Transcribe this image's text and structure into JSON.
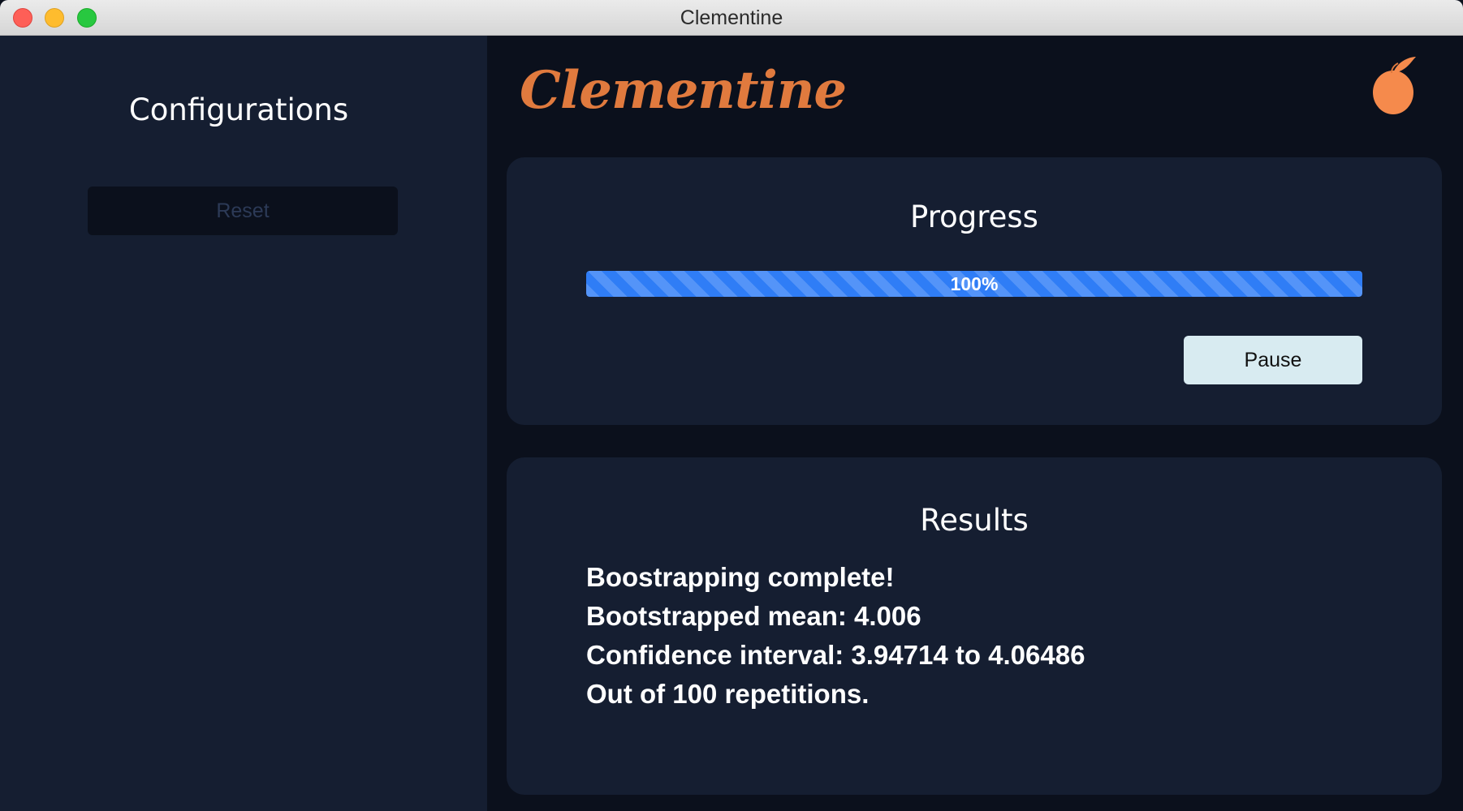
{
  "window": {
    "title": "Clementine"
  },
  "sidebar": {
    "heading": "Configurations",
    "reset_label": "Reset"
  },
  "header": {
    "brand": "Clementine",
    "logo_icon": "orange-fruit-icon"
  },
  "progress": {
    "title": "Progress",
    "percent": 100,
    "label": "100%",
    "pause_label": "Pause"
  },
  "results": {
    "title": "Results",
    "lines": [
      "Boostrapping complete!",
      "Bootstrapped mean: 4.006",
      "Confidence interval: 3.94714 to 4.06486",
      "Out of 100 repetitions."
    ]
  },
  "colors": {
    "accent_orange": "#e07a3e",
    "progress_blue": "#2f7df6",
    "panel": "#151e31",
    "background": "#0b101c",
    "pause_button": "#d8ebf1"
  }
}
